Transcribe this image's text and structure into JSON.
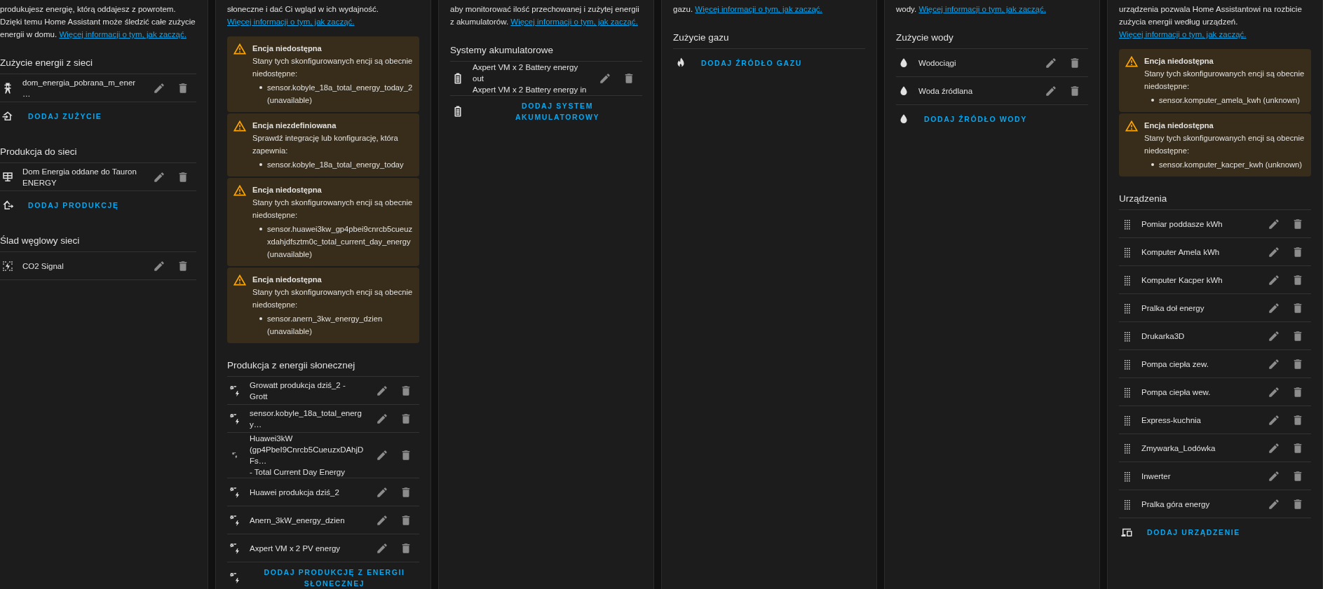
{
  "cards": [
    {
      "intro": "produkujesz energię, którą oddajesz z powrotem. Dzięki temu Home Assistant może śledzić całe zużycie energii w domu.",
      "link": "Więcej informacji o tym, jak zacząć.",
      "sections": [
        {
          "heading": "Zużycie energii z sieci",
          "items": [
            {
              "kind": "grid",
              "lines": [
                "dom_energia_pobrana_m_ener…"
              ]
            }
          ],
          "add": {
            "kind": "import",
            "label": "DODAJ ZUŻYCIE"
          }
        },
        {
          "heading": "Produkcja do sieci",
          "items": [
            {
              "kind": "panel",
              "lines": [
                "Dom Energia oddane do Tauron ENERGY"
              ]
            }
          ],
          "add": {
            "kind": "export",
            "label": "DODAJ PRODUKCJĘ"
          }
        },
        {
          "heading": "Ślad węglowy sieci",
          "items": [
            {
              "kind": "co2",
              "lines": [
                "CO2 Signal"
              ]
            }
          ]
        }
      ]
    },
    {
      "intro": "słoneczne i dać Ci wgląd w ich wydajność.",
      "link": "Więcej informacji o tym, jak zacząć.",
      "alerts": [
        {
          "title": "Encja niedostępna",
          "message": "Stany tych skonfigurowanych encji są obecnie niedostępne:",
          "entities": [
            "sensor.kobyle_18a_total_energy_today_2 (unavailable)"
          ]
        },
        {
          "title": "Encja niezdefiniowana",
          "message": "Sprawdź integrację lub konfigurację, która zapewnia:",
          "entities": [
            "sensor.kobyle_18a_total_energy_today"
          ]
        },
        {
          "title": "Encja niedostępna",
          "message": "Stany tych skonfigurowanych encji są obecnie niedostępne:",
          "entities": [
            "sensor.huawei3kw_gp4pbei9cnrcb5cueuzxdahjdfsztm0c_total_current_day_energy (unavailable)"
          ]
        },
        {
          "title": "Encja niedostępna",
          "message": "Stany tych skonfigurowanych encji są obecnie niedostępne:",
          "entities": [
            "sensor.anern_3kw_energy_dzien (unavailable)"
          ]
        }
      ],
      "sections": [
        {
          "heading": "Produkcja z energii słonecznej",
          "items": [
            {
              "kind": "solar",
              "lines": [
                "Growatt produkcja dziś_2 - Grott"
              ]
            },
            {
              "kind": "solar",
              "lines": [
                "sensor.kobyle_18a_total_energy…"
              ]
            },
            {
              "kind": "solar-small",
              "lines": [
                "Huawei3kW",
                "(gp4PbeI9Cnrcb5CueuzxDAhjDFs…",
                "- Total Current Day Energy"
              ]
            },
            {
              "kind": "solar",
              "lines": [
                "Huawei produkcja dziś_2"
              ]
            },
            {
              "kind": "solar",
              "lines": [
                "Anern_3kW_energy_dzien"
              ]
            },
            {
              "kind": "solar",
              "lines": [
                "Axpert VM x 2 PV energy"
              ]
            }
          ],
          "add": {
            "kind": "solar",
            "label": "DODAJ PRODUKCJĘ Z ENERGII SŁONECZNEJ"
          }
        }
      ]
    },
    {
      "intro": "aby monitorować ilość przechowanej i zużytej energii z akumulatorów.",
      "link": "Więcej informacji o tym, jak zacząć.",
      "sections": [
        {
          "heading": "Systemy akumulatorowe",
          "items": [
            {
              "kind": "battery",
              "lines": [
                "Axpert VM x 2 Battery energy out",
                "Axpert VM x 2 Battery energy in"
              ]
            }
          ],
          "add": {
            "kind": "battery",
            "label": "DODAJ SYSTEM AKUMULATOROWY"
          }
        }
      ]
    },
    {
      "intro": "gazu.",
      "link": "Więcej informacji o tym, jak zacząć.",
      "sections": [
        {
          "heading": "Zużycie gazu",
          "add": {
            "kind": "gas",
            "label": "DODAJ ŹRÓDŁO GAZU"
          }
        }
      ]
    },
    {
      "intro": "wody.",
      "link": "Więcej informacji o tym, jak zacząć.",
      "sections": [
        {
          "heading": "Zużycie wody",
          "items": [
            {
              "kind": "water",
              "lines": [
                "Wodociągi"
              ]
            },
            {
              "kind": "water",
              "lines": [
                "Woda źródlana"
              ]
            }
          ],
          "add": {
            "kind": "water",
            "label": "DODAJ ŹRÓDŁO WODY"
          }
        }
      ]
    },
    {
      "intro": "urządzenia pozwala Home Assistantowi na rozbicie zużycia energii według urządzeń.",
      "link": "Więcej informacji o tym, jak zacząć.",
      "alerts": [
        {
          "title": "Encja niedostępna",
          "message": "Stany tych skonfigurowanych encji są obecnie niedostępne:",
          "entities": [
            "sensor.komputer_amela_kwh (unknown)"
          ]
        },
        {
          "title": "Encja niedostępna",
          "message": "Stany tych skonfigurowanych encji są obecnie niedostępne:",
          "entities": [
            "sensor.komputer_kacper_kwh (unknown)"
          ]
        }
      ],
      "sections": [
        {
          "heading": "Urządzenia",
          "items": [
            {
              "kind": "device",
              "lines": [
                "Pomiar poddasze kWh"
              ]
            },
            {
              "kind": "device",
              "lines": [
                "Komputer Amela kWh"
              ]
            },
            {
              "kind": "device",
              "lines": [
                "Komputer Kacper kWh"
              ]
            },
            {
              "kind": "device",
              "lines": [
                "Pralka doł energy"
              ]
            },
            {
              "kind": "device",
              "lines": [
                "Drukarka3D"
              ]
            },
            {
              "kind": "device",
              "lines": [
                "Pompa ciepła zew."
              ]
            },
            {
              "kind": "device",
              "lines": [
                "Pompa ciepła wew."
              ]
            },
            {
              "kind": "device",
              "lines": [
                "Express-kuchnia"
              ]
            },
            {
              "kind": "device",
              "lines": [
                "Zmywarka_Lodówka"
              ]
            },
            {
              "kind": "device",
              "lines": [
                "Inwerter"
              ]
            },
            {
              "kind": "device",
              "lines": [
                "Pralka góra energy"
              ]
            }
          ],
          "add": {
            "kind": "devices",
            "label": "DODAJ URZĄDZENIE"
          }
        }
      ]
    }
  ]
}
